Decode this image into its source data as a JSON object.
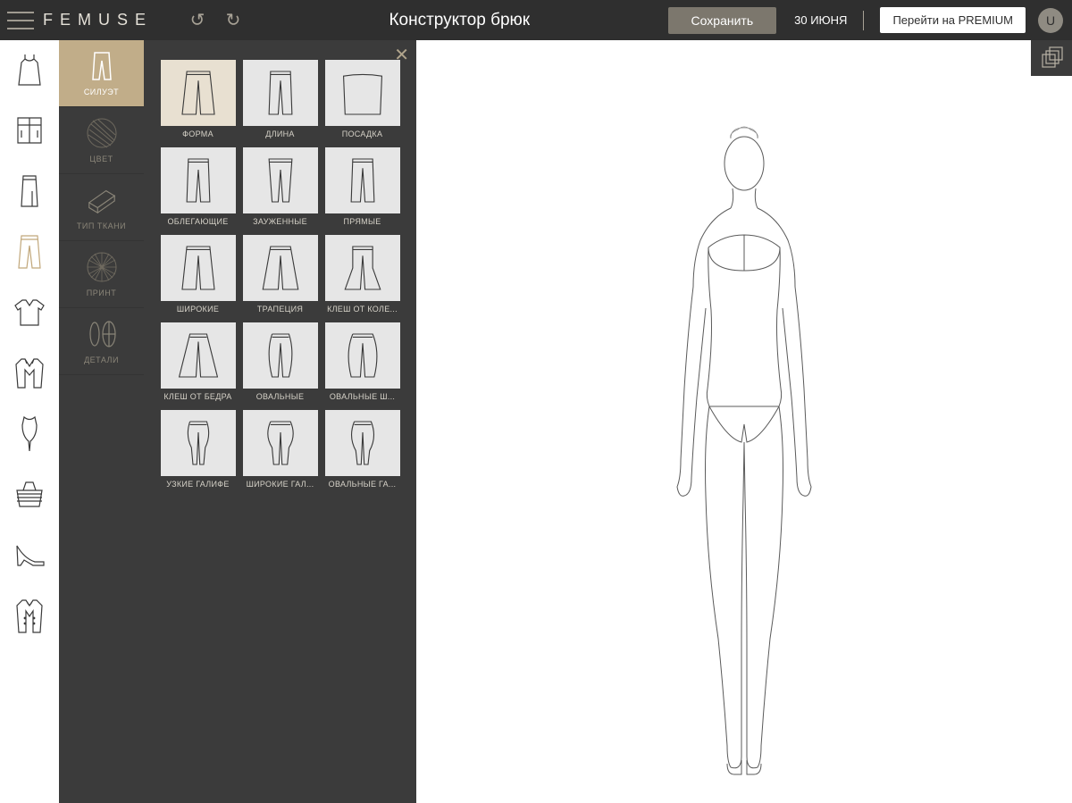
{
  "header": {
    "brand": "FEMUSE",
    "title": "Конструктор брюк",
    "save": "Сохранить",
    "date": "30 ИЮНЯ",
    "premium": "Перейти на PREMIUM",
    "avatar_initial": "U"
  },
  "garments": [
    {
      "id": "dress"
    },
    {
      "id": "shirt"
    },
    {
      "id": "skirt"
    },
    {
      "id": "pants",
      "active": true
    },
    {
      "id": "sweater"
    },
    {
      "id": "jacket"
    },
    {
      "id": "bodysuit"
    },
    {
      "id": "bag"
    },
    {
      "id": "heel"
    },
    {
      "id": "coat"
    }
  ],
  "categories": [
    {
      "id": "silhouette",
      "label": "СИЛУЭТ",
      "active": true
    },
    {
      "id": "color",
      "label": "ЦВЕТ"
    },
    {
      "id": "fabric",
      "label": "ТИП ТКАНИ"
    },
    {
      "id": "print",
      "label": "ПРИНТ"
    },
    {
      "id": "details",
      "label": "ДЕТАЛИ"
    }
  ],
  "tiles": [
    {
      "label": "ФОРМА",
      "active": true,
      "shape": "pants_wide"
    },
    {
      "label": "ДЛИНА",
      "shape": "pants_straight"
    },
    {
      "label": "ПОСАДКА",
      "shape": "waist"
    },
    {
      "label": "ОБЛЕГАЮЩИЕ",
      "shape": "pants_slim"
    },
    {
      "label": "ЗАУЖЕННЫЕ",
      "shape": "pants_taper"
    },
    {
      "label": "ПРЯМЫЕ",
      "shape": "pants_straight"
    },
    {
      "label": "ШИРОКИЕ",
      "shape": "pants_wide"
    },
    {
      "label": "ТРАПЕЦИЯ",
      "shape": "pants_flare"
    },
    {
      "label": "КЛЕШ ОТ КОЛЕ...",
      "shape": "pants_bell"
    },
    {
      "label": "КЛЕШ ОТ БЕДРА",
      "shape": "pants_flarehip"
    },
    {
      "label": "ОВАЛЬНЫЕ",
      "shape": "pants_oval"
    },
    {
      "label": "ОВАЛЬНЫЕ Ш...",
      "shape": "pants_ovalw"
    },
    {
      "label": "УЗКИЕ ГАЛИФЕ",
      "shape": "pants_jodhpur"
    },
    {
      "label": "ШИРОКИЕ ГАЛ...",
      "shape": "pants_jodhpurw"
    },
    {
      "label": "ОВАЛЬНЫЕ ГА...",
      "shape": "pants_ovaljod"
    }
  ]
}
